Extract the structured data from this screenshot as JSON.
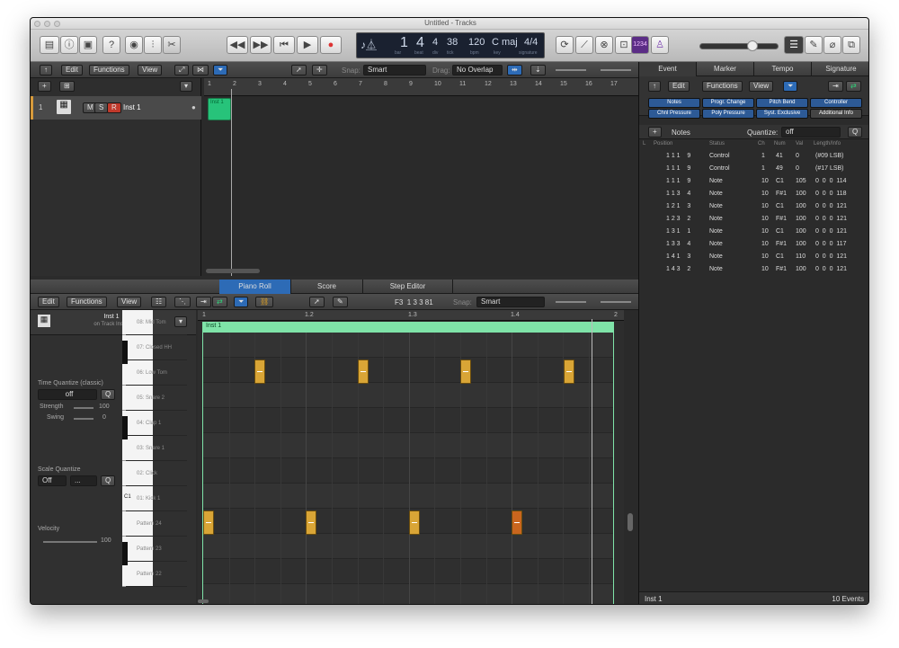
{
  "window": {
    "title": "Untitled - Tracks"
  },
  "lcd": {
    "bar": "1",
    "beat": "4",
    "div": "4",
    "tick": "38",
    "tempo": "120",
    "key": "C maj",
    "signature": "4/4",
    "labels": [
      "bar",
      "beat",
      "div",
      "tick",
      "bpm",
      "key",
      "signature"
    ]
  },
  "tracks_area": {
    "menu": [
      "Edit",
      "Functions",
      "View"
    ],
    "snap_label": "Snap:",
    "snap_value": "Smart",
    "drag_label": "Drag:",
    "drag_value": "No Overlap",
    "ruler": [
      "1",
      "2",
      "3",
      "4",
      "5",
      "6",
      "7",
      "8",
      "9",
      "10",
      "11",
      "12",
      "13",
      "14",
      "15",
      "16",
      "17"
    ],
    "track": {
      "number": "1",
      "mute": "M",
      "solo": "S",
      "record": "R",
      "name": "Inst 1"
    },
    "region_name": "Inst 1"
  },
  "editor": {
    "tabs": [
      "Piano Roll",
      "Score",
      "Step Editor"
    ],
    "menu": [
      "Edit",
      "Functions",
      "View"
    ],
    "position": "F3  1 3 3 81",
    "snap_label": "Snap:",
    "snap_value": "Smart",
    "track_name": "Inst 1",
    "track_sub": "on Track Inst 1",
    "ruler": [
      "1",
      "1.2",
      "1.3",
      "1.4",
      "2"
    ],
    "region_name": "Inst 1",
    "time_quantize": {
      "label": "Time Quantize (classic)",
      "value": "off",
      "q": "Q",
      "strength_label": "Strength",
      "strength_value": "100",
      "swing_label": "Swing",
      "swing_value": "0"
    },
    "scale_quantize": {
      "label": "Scale Quantize",
      "value": "Off",
      "value2": "...",
      "q": "Q"
    },
    "velocity": {
      "label": "Velocity",
      "value": "100"
    },
    "c1_label": "C1",
    "lanes": [
      "08: Mid Tom",
      "07: Closed HH",
      "06: Low Tom",
      "05: Snare 2",
      "04: Clap 1",
      "03: Snare 1",
      "02: Click",
      "01: Kick 1",
      "Pattern 24",
      "Pattern 23",
      "Pattern 22"
    ]
  },
  "inspector": {
    "tabs": [
      "Event",
      "Marker",
      "Tempo",
      "Signature"
    ],
    "menu": [
      "Edit",
      "Functions",
      "View"
    ],
    "filters": [
      "Notes",
      "Progr. Change",
      "Pitch Bend",
      "Controller",
      "Chnl Pressure",
      "Poly Pressure",
      "Syst. Exclusive",
      "Additional Info"
    ],
    "notes_label": "Notes",
    "quantize_label": "Quantize:",
    "quantize_value": "off",
    "q": "Q",
    "columns": [
      "L",
      "Position",
      "Status",
      "Ch",
      "Num",
      "Val",
      "Length/Info"
    ],
    "events": [
      {
        "pos": "1 1 1    9",
        "status": "Control",
        "ch": "1",
        "num": "41",
        "val": "0",
        "len": "(#09 LSB)"
      },
      {
        "pos": "1 1 1    9",
        "status": "Control",
        "ch": "1",
        "num": "49",
        "val": "0",
        "len": "(#17 LSB)"
      },
      {
        "pos": "1 1 1    9",
        "status": "Note",
        "ch": "10",
        "num": "C1",
        "val": "105",
        "len": "0  0  0  114"
      },
      {
        "pos": "1 1 3    4",
        "status": "Note",
        "ch": "10",
        "num": "F#1",
        "val": "100",
        "len": "0  0  0  118"
      },
      {
        "pos": "1 2 1    3",
        "status": "Note",
        "ch": "10",
        "num": "C1",
        "val": "100",
        "len": "0  0  0  121"
      },
      {
        "pos": "1 2 3    2",
        "status": "Note",
        "ch": "10",
        "num": "F#1",
        "val": "100",
        "len": "0  0  0  121"
      },
      {
        "pos": "1 3 1    1",
        "status": "Note",
        "ch": "10",
        "num": "C1",
        "val": "100",
        "len": "0  0  0  121"
      },
      {
        "pos": "1 3 3    4",
        "status": "Note",
        "ch": "10",
        "num": "F#1",
        "val": "100",
        "len": "0  0  0  117"
      },
      {
        "pos": "1 4 1    3",
        "status": "Note",
        "ch": "10",
        "num": "C1",
        "val": "110",
        "len": "0  0  0  121"
      },
      {
        "pos": "1 4 3    2",
        "status": "Note",
        "ch": "10",
        "num": "F#1",
        "val": "100",
        "len": "0  0  0  121"
      }
    ],
    "footer_left": "Inst 1",
    "footer_right": "10 Events"
  }
}
